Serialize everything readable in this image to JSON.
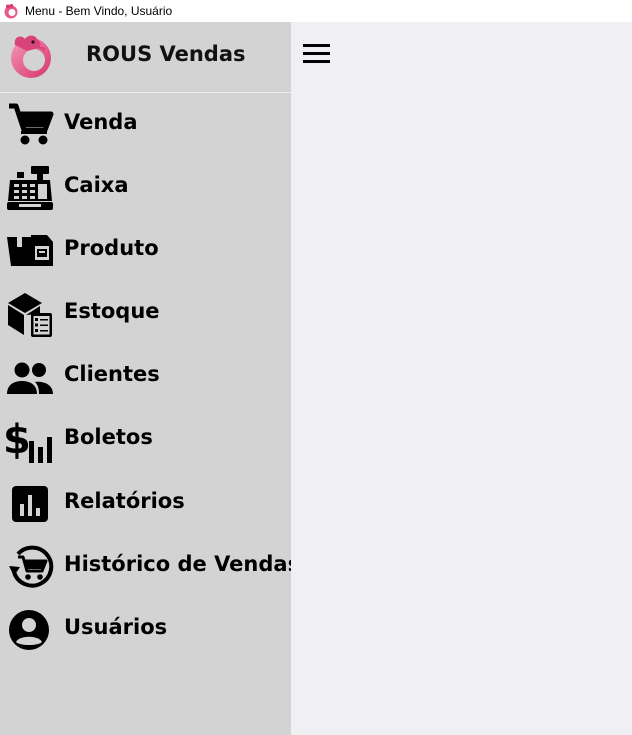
{
  "window": {
    "title": "Menu - Bem Vindo, Usuário"
  },
  "brand": {
    "name": "ROUS Vendas",
    "logo_icon": "rat-logo-icon",
    "logo_colors": [
      "#f27ba0",
      "#d83a6b"
    ]
  },
  "sidebar": {
    "background": "#d3d3d3",
    "items": [
      {
        "label": "Venda",
        "icon": "shopping-cart-icon"
      },
      {
        "label": "Caixa",
        "icon": "cash-register-icon"
      },
      {
        "label": "Produto",
        "icon": "product-box-icon"
      },
      {
        "label": "Estoque",
        "icon": "inventory-icon"
      },
      {
        "label": "Clientes",
        "icon": "people-icon"
      },
      {
        "label": "Boletos",
        "icon": "dollar-chart-icon"
      },
      {
        "label": "Relatórios",
        "icon": "bar-chart-icon"
      },
      {
        "label": "Histórico de Vendas",
        "icon": "cart-history-icon"
      },
      {
        "label": "Usuários",
        "icon": "user-circle-icon"
      }
    ]
  },
  "content": {
    "background": "#f0f0f4",
    "menu_toggle_icon": "hamburger-menu-icon"
  }
}
